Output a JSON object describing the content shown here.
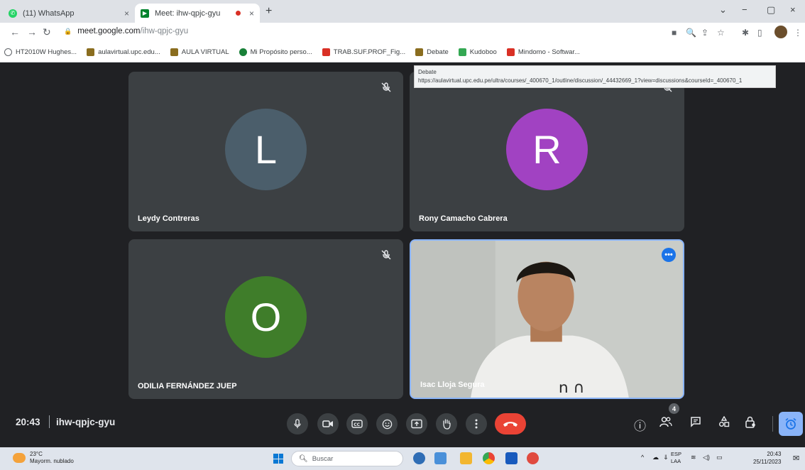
{
  "browser": {
    "tabs": [
      {
        "title": "(11) WhatsApp",
        "close": "×"
      },
      {
        "title": "Meet: ihw-qpjc-gyu",
        "close": "×"
      }
    ],
    "new_tab": "+",
    "window_controls": {
      "search_tabs": "⌄",
      "minimize": "−",
      "maximize": "▢",
      "close": "×"
    },
    "url": {
      "host": "meet.google.com",
      "path": "/ihw-qpjc-gyu"
    },
    "bookmarks": [
      {
        "label": "HT2010W Hughes...",
        "color": "#5f6368"
      },
      {
        "label": "aulavirtual.upc.edu...",
        "color": "#1b1b1b"
      },
      {
        "label": "AULA VIRTUAL",
        "color": "#1b1b1b"
      },
      {
        "label": "Mi Propósito perso...",
        "color": "#188038"
      },
      {
        "label": "TRAB.SUF.PROF_Fig...",
        "color": "#d93025"
      },
      {
        "label": "Debate",
        "color": "#1b1b1b"
      },
      {
        "label": "Kudoboo",
        "color": "#34a853"
      },
      {
        "label": "Mindomo - Softwar...",
        "color": "#d93025"
      }
    ],
    "tooltip": {
      "title": "Debate",
      "url": "https://aulavirtual.upc.edu.pe/ultra/courses/_400670_1/outline/discussion/_44432669_1?view=discussions&courseId=_400670_1"
    }
  },
  "meet": {
    "participants": [
      {
        "name": "Leydy Contreras",
        "initial": "L",
        "color": "#4b5e6b",
        "muted": true
      },
      {
        "name": "Rony Camacho Cabrera",
        "initial": "R",
        "color": "#a142c2",
        "muted": true
      },
      {
        "name": "ODILIA FERNÁNDEZ JUEP",
        "initial": "O",
        "color": "#3f7d2a",
        "muted": true
      },
      {
        "name": "Isac Lloja Segura",
        "initial": "",
        "color": "#1a73e8",
        "muted": false
      }
    ],
    "more_options": "•••",
    "time": "20:43",
    "meeting_code": "ihw-qpjc-gyu",
    "people_count": "4"
  },
  "taskbar": {
    "weather": {
      "temp": "23°C",
      "desc": "Mayorm. nublado"
    },
    "search_placeholder": "Buscar",
    "lang": {
      "line1": "ESP",
      "line2": "LAA"
    },
    "clock": {
      "time": "20:43",
      "date": "25/11/2023"
    }
  }
}
